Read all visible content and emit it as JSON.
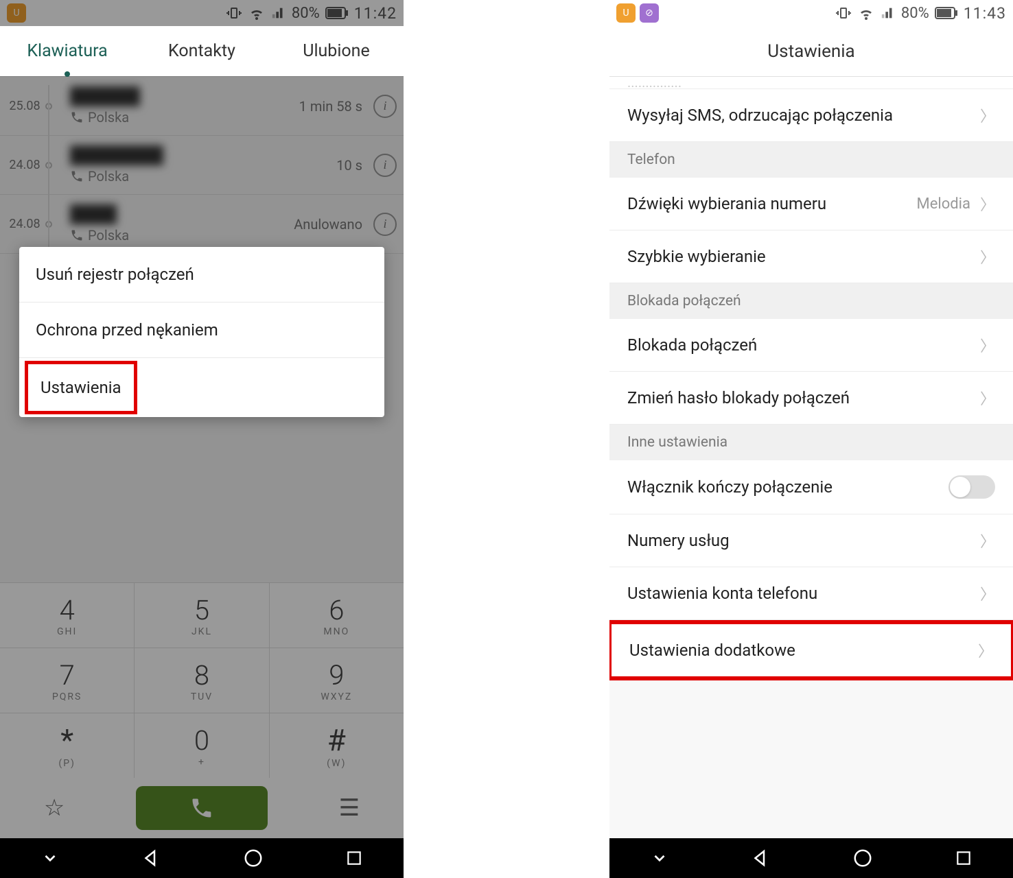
{
  "left": {
    "status": {
      "battery": "80%",
      "time": "11:42"
    },
    "tabs": [
      "Klawiatura",
      "Kontakty",
      "Ulubione"
    ],
    "calls": [
      {
        "date": "25.08",
        "name": "██████",
        "country": "Polska",
        "duration": "1 min  58 s"
      },
      {
        "date": "24.08",
        "name": "████████",
        "country": "Polska",
        "duration": "10 s"
      },
      {
        "date": "24.08",
        "name": "████",
        "country": "Polska",
        "duration": "Anulowano"
      }
    ],
    "popup": {
      "items": [
        "Usuń rejestr połączeń",
        "Ochrona przed nękaniem",
        "Ustawienia"
      ]
    },
    "keypad": [
      {
        "num": "4",
        "letters": "GHI"
      },
      {
        "num": "5",
        "letters": "JKL"
      },
      {
        "num": "6",
        "letters": "MNO"
      },
      {
        "num": "7",
        "letters": "PQRS"
      },
      {
        "num": "8",
        "letters": "TUV"
      },
      {
        "num": "9",
        "letters": "WXYZ"
      },
      {
        "num": "*",
        "letters": "(P)"
      },
      {
        "num": "0",
        "letters": "+"
      },
      {
        "num": "#",
        "letters": "(W)"
      }
    ]
  },
  "right": {
    "status": {
      "battery": "80%",
      "time": "11:43"
    },
    "title": "Ustawienia",
    "items": {
      "sms_reject": "Wysyłaj SMS, odrzucając połączenia",
      "sec_telefon": "Telefon",
      "dial_sounds": "Dźwięki wybierania numeru",
      "dial_sounds_val": "Melodia",
      "speed_dial": "Szybkie wybieranie",
      "sec_blokada": "Blokada połączeń",
      "call_barring": "Blokada połączeń",
      "change_pw": "Zmień hasło blokady połączeń",
      "sec_inne": "Inne ustawienia",
      "power_ends": "Włącznik kończy połączenie",
      "service_nums": "Numery usług",
      "account": "Ustawienia konta telefonu",
      "additional": "Ustawienia dodatkowe"
    }
  }
}
